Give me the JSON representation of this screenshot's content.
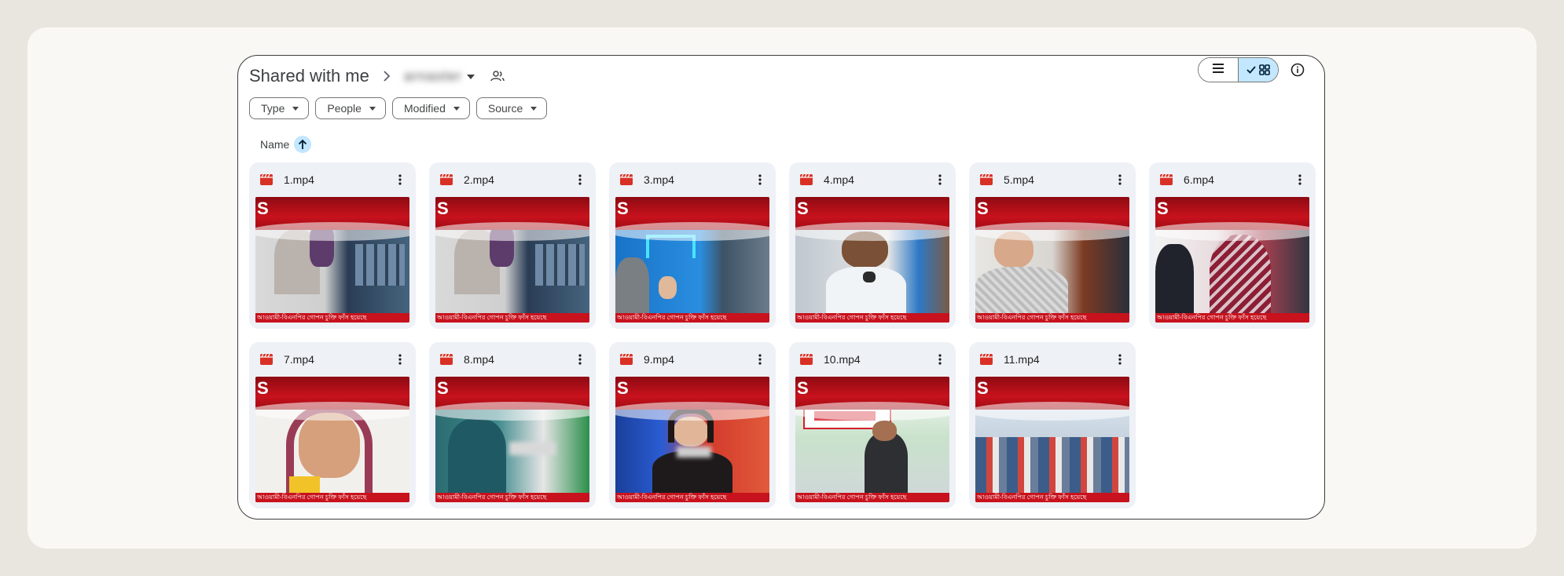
{
  "breadcrumb": {
    "root": "Shared with me",
    "current_folder": "arnaster"
  },
  "view_toggle": {
    "list_icon": "list-icon",
    "grid_icon": "grid-icon",
    "active": "grid"
  },
  "filters": [
    {
      "label": "Type"
    },
    {
      "label": "People"
    },
    {
      "label": "Modified"
    },
    {
      "label": "Source"
    }
  ],
  "sort": {
    "label": "Name",
    "direction": "ascending"
  },
  "files": [
    {
      "name": "1.mp4",
      "scene": "studio"
    },
    {
      "name": "2.mp4",
      "scene": "studio"
    },
    {
      "name": "3.mp4",
      "scene": "blue"
    },
    {
      "name": "4.mp4",
      "scene": "speaker"
    },
    {
      "name": "5.mp4",
      "scene": "elder"
    },
    {
      "name": "6.mp4",
      "scene": "crowd"
    },
    {
      "name": "7.mp4",
      "scene": "portrait"
    },
    {
      "name": "8.mp4",
      "scene": "police"
    },
    {
      "name": "9.mp4",
      "scene": "anchor"
    },
    {
      "name": "10.mp4",
      "scene": "rally"
    },
    {
      "name": "11.mp4",
      "scene": "protest"
    }
  ],
  "thumbnail": {
    "logo": "S",
    "ticker": "আওয়ামী-বিএনপির গোপন চুক্তি ফাঁস হয়েছে"
  },
  "colors": {
    "accent_selected": "#c2e7ff",
    "video_icon": "#d93025",
    "tile_bg": "#eef1f6"
  }
}
